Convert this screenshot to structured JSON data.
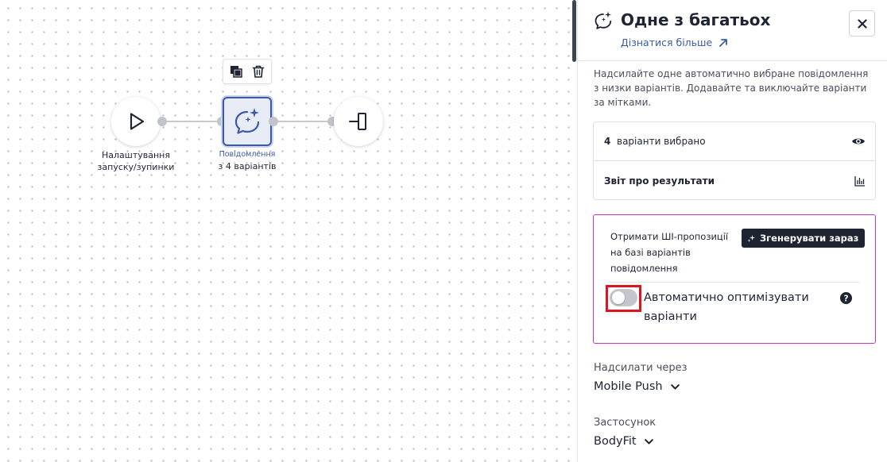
{
  "workflow": {
    "start_node": {
      "label_line1": "Налаштування",
      "label_line2": "запуску/зупинки"
    },
    "message_node": {
      "label_top": "Повідомлення",
      "label_bottom": "з 4 варіантів"
    },
    "end_node": {}
  },
  "panel": {
    "title": "Одне з багатьох",
    "learn_more": "Дізнатися більше",
    "description": "Надсилайте одне автоматично вибране повідомлення з низки варіантів. Додавайте та виключайте варіанти за мітками.",
    "variants_count": "4",
    "variants_text": "варіанти вибрано",
    "report_label": "Звіт про результати",
    "ai_text": "Отримати ШІ-пропозиції на базі варіантів повідомлення",
    "generate_button": "Згенерувати зараз",
    "auto_optimize_label": "Автоматично оптимізувати варіанти",
    "auto_optimize_enabled": false,
    "send_via_label": "Надсилати через",
    "send_via_value": "Mobile Push",
    "app_label": "Застосунок",
    "app_value": "BodyFit"
  },
  "colors": {
    "accent": "#3a5ba8",
    "ai_border": "#c936b7",
    "highlight": "#e0141e",
    "dark_button": "#1f2433"
  }
}
